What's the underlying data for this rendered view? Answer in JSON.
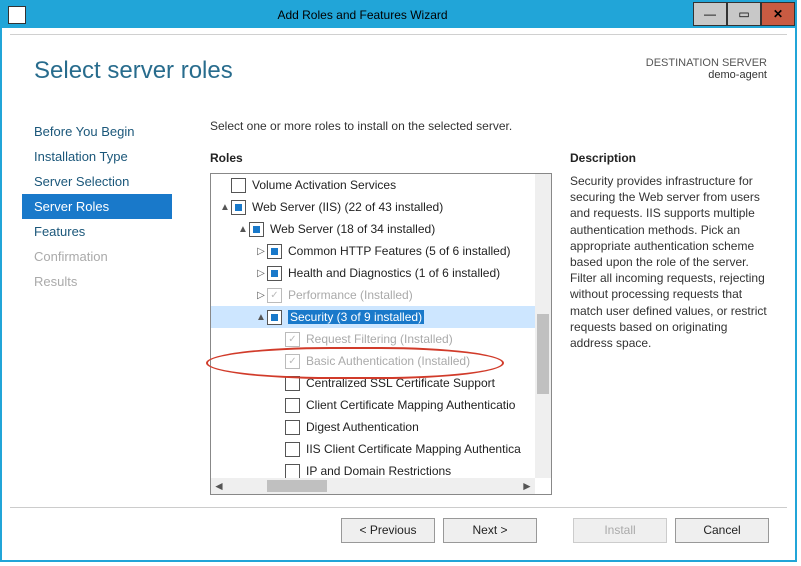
{
  "window": {
    "title": "Add Roles and Features Wizard"
  },
  "heading": "Select server roles",
  "destination": {
    "label": "DESTINATION SERVER",
    "name": "demo-agent"
  },
  "nav": [
    {
      "label": "Before You Begin",
      "dim": false
    },
    {
      "label": "Installation Type",
      "dim": false
    },
    {
      "label": "Server Selection",
      "dim": false
    },
    {
      "label": "Server Roles",
      "dim": false,
      "active": true
    },
    {
      "label": "Features",
      "dim": false
    },
    {
      "label": "Confirmation",
      "dim": true
    },
    {
      "label": "Results",
      "dim": true
    }
  ],
  "instructions": "Select one or more roles to install on the selected server.",
  "labels": {
    "roles": "Roles",
    "description": "Description"
  },
  "description_text": "Security provides infrastructure for securing the Web server from users and requests. IIS supports multiple authentication methods. Pick an appropriate authentication scheme based upon the role of the server. Filter all incoming requests, rejecting without processing requests that match user defined values, or restrict requests based on originating address space.",
  "tree": [
    {
      "indent": 0,
      "exp": "",
      "chk": "empty",
      "label": "Volume Activation Services"
    },
    {
      "indent": 0,
      "exp": "▲",
      "chk": "partial",
      "label": "Web Server (IIS) (22 of 43 installed)"
    },
    {
      "indent": 1,
      "exp": "▲",
      "chk": "partial",
      "label": "Web Server (18 of 34 installed)"
    },
    {
      "indent": 2,
      "exp": "▷",
      "chk": "partial",
      "label": "Common HTTP Features (5 of 6 installed)"
    },
    {
      "indent": 2,
      "exp": "▷",
      "chk": "partial",
      "label": "Health and Diagnostics (1 of 6 installed)"
    },
    {
      "indent": 2,
      "exp": "▷",
      "chk": "checked",
      "label": "Performance (Installed)",
      "dim": true
    },
    {
      "indent": 2,
      "exp": "▲",
      "chk": "partial",
      "label": "Security (3 of 9 installed)",
      "selected": true
    },
    {
      "indent": 3,
      "exp": "",
      "chk": "checked",
      "label": "Request Filtering (Installed)",
      "dim": true
    },
    {
      "indent": 3,
      "exp": "",
      "chk": "checked",
      "label": "Basic Authentication (Installed)",
      "dim": true,
      "annot": true
    },
    {
      "indent": 3,
      "exp": "",
      "chk": "empty",
      "label": "Centralized SSL Certificate Support"
    },
    {
      "indent": 3,
      "exp": "",
      "chk": "empty",
      "label": "Client Certificate Mapping Authenticatio"
    },
    {
      "indent": 3,
      "exp": "",
      "chk": "empty",
      "label": "Digest Authentication"
    },
    {
      "indent": 3,
      "exp": "",
      "chk": "empty",
      "label": "IIS Client Certificate Mapping Authentica"
    },
    {
      "indent": 3,
      "exp": "",
      "chk": "empty",
      "label": "IP and Domain Restrictions"
    }
  ],
  "buttons": {
    "previous": "<  Previous",
    "next": "Next  >",
    "install": "Install",
    "cancel": "Cancel"
  }
}
